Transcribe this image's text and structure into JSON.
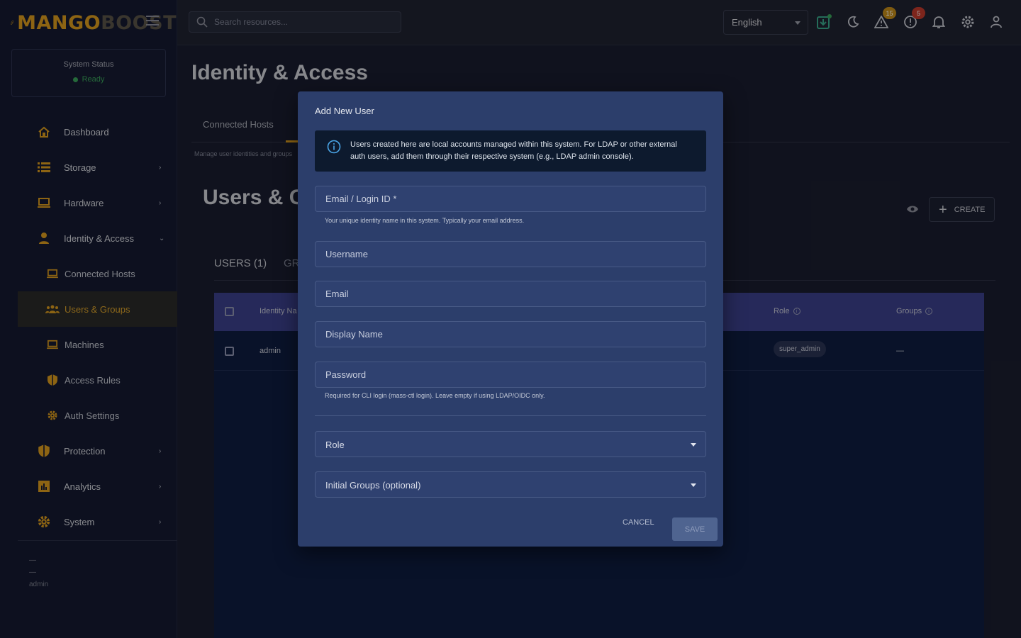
{
  "brand": {
    "part1": "MANGO",
    "part2": "BOOST"
  },
  "status": {
    "title": "System Status",
    "value": "Ready",
    "color": "#3aa35a"
  },
  "sidebar": {
    "items": [
      {
        "label": "Dashboard",
        "icon": "home-icon"
      },
      {
        "label": "Storage",
        "icon": "storage-icon"
      },
      {
        "label": "Hardware",
        "icon": "laptop-icon"
      },
      {
        "label": "Identity & Access",
        "icon": "person-icon"
      },
      {
        "label": "Connected Hosts",
        "icon": "laptop-icon"
      },
      {
        "label": "Users & Groups",
        "icon": "group-icon"
      },
      {
        "label": "Machines",
        "icon": "laptop-icon"
      },
      {
        "label": "Access Rules",
        "icon": "shield-icon"
      },
      {
        "label": "Auth Settings",
        "icon": "gear-icon"
      },
      {
        "label": "Protection",
        "icon": "shield-icon"
      },
      {
        "label": "Analytics",
        "icon": "analytics-icon"
      },
      {
        "label": "System",
        "icon": "gear-icon"
      }
    ],
    "user_line1": "—",
    "user_line2": "—",
    "user_name": "admin"
  },
  "topbar": {
    "search_placeholder": "Search resources...",
    "language": "English",
    "warning_count": "15",
    "error_count": "5",
    "accent": "#d99a1e"
  },
  "page": {
    "title": "Identity & Access",
    "tab_connected": "Connected Hosts",
    "manage_text": "Manage user identities and groups",
    "section_title": "Users & G",
    "create_label": "CREATE",
    "users_tab": "USERS (1)",
    "groups_tab": "GR",
    "table": {
      "headers": {
        "identity": "Identity Na",
        "role": "Role",
        "groups": "Groups"
      },
      "rows": [
        {
          "identity": "admin",
          "role": "super_admin",
          "groups": "—"
        }
      ]
    }
  },
  "modal": {
    "title": "Add New User",
    "info": "Users created here are local accounts managed within this system. For LDAP or other external auth users, add them through their respective system (e.g., LDAP admin console).",
    "fields": {
      "login": {
        "placeholder": "Email / Login ID *",
        "helper": "Your unique identity name in this system. Typically your email address."
      },
      "username": {
        "placeholder": "Username"
      },
      "email": {
        "placeholder": "Email"
      },
      "display_name": {
        "placeholder": "Display Name"
      },
      "password": {
        "placeholder": "Password",
        "helper": "Required for CLI login (mass-ctl login). Leave empty if using LDAP/OIDC only."
      }
    },
    "role_label": "Role",
    "groups_label": "Initial Groups (optional)",
    "cancel": "CANCEL",
    "save": "SAVE"
  }
}
